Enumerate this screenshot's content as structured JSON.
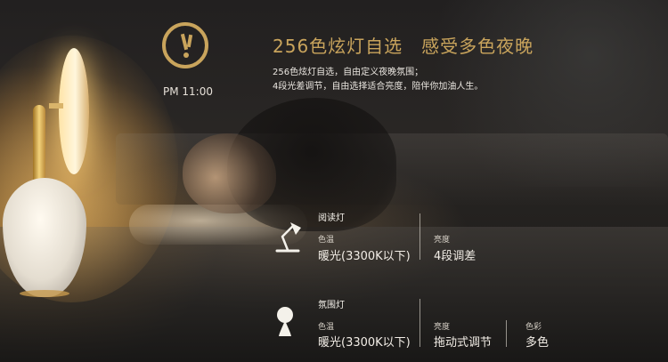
{
  "clock": {
    "time": "PM 11:00"
  },
  "headline": "256色炫灯自选　感受多色夜晚",
  "description": [
    "256色炫灯自选，自由定义夜晚氛围；",
    "4段光差调节，自由选择适合亮度，陪伴你加油人生。"
  ],
  "modes": [
    {
      "name": "阅读灯",
      "icon": "desk-lamp-icon",
      "specs": [
        {
          "label": "色温",
          "value": "暖光(3300K以下)"
        },
        {
          "label": "亮度",
          "value": "4段调差"
        }
      ]
    },
    {
      "name": "氛围灯",
      "icon": "mood-lamp-icon",
      "specs": [
        {
          "label": "色温",
          "value": "暖光(3300K以下)"
        },
        {
          "label": "亮度",
          "value": "拖动式调节"
        },
        {
          "label": "色彩",
          "value": "多色"
        }
      ]
    }
  ],
  "colors": {
    "accent": "#c9a45c",
    "text": "#f2ede6"
  }
}
